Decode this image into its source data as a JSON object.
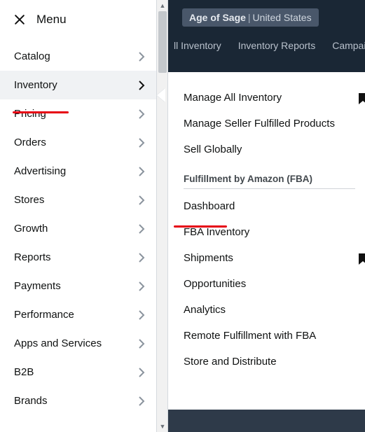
{
  "header": {
    "menu_label": "Menu",
    "brand_name": "Age of Sage",
    "brand_region": "United States"
  },
  "bg_tabs": [
    "ll Inventory",
    "Inventory Reports",
    "Campaign M"
  ],
  "left_nav": [
    {
      "label": "Catalog"
    },
    {
      "label": "Inventory"
    },
    {
      "label": "Pricing"
    },
    {
      "label": "Orders"
    },
    {
      "label": "Advertising"
    },
    {
      "label": "Stores"
    },
    {
      "label": "Growth"
    },
    {
      "label": "Reports"
    },
    {
      "label": "Payments"
    },
    {
      "label": "Performance"
    },
    {
      "label": "Apps and Services"
    },
    {
      "label": "B2B"
    },
    {
      "label": "Brands"
    }
  ],
  "flyout": {
    "top": [
      {
        "label": "Manage All Inventory",
        "bookmark": true
      },
      {
        "label": "Manage Seller Fulfilled Products"
      },
      {
        "label": "Sell Globally"
      }
    ],
    "section_label": "Fulfillment by Amazon (FBA)",
    "fba": [
      {
        "label": "Dashboard"
      },
      {
        "label": "FBA Inventory"
      },
      {
        "label": "Shipments",
        "bookmark": true
      },
      {
        "label": "Opportunities"
      },
      {
        "label": "Analytics"
      },
      {
        "label": "Remote Fulfillment with FBA"
      },
      {
        "label": "Store and Distribute"
      }
    ]
  }
}
